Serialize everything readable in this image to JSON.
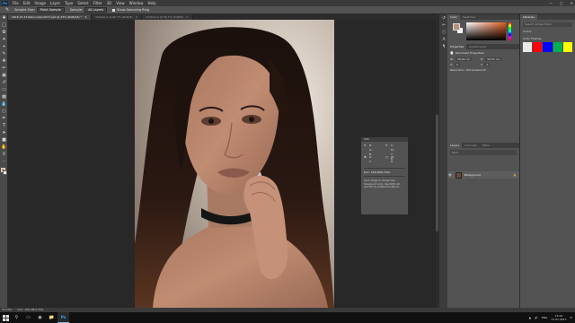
{
  "app": {
    "menu": [
      "File",
      "Edit",
      "Image",
      "Layer",
      "Type",
      "Select",
      "Filter",
      "3D",
      "View",
      "Window",
      "Help"
    ],
    "window_controls": [
      "minimize",
      "maximize",
      "close"
    ]
  },
  "options_bar": {
    "shape_label": "Sample Size:",
    "shape_value": "Point Sample",
    "sample_label": "Sample:",
    "sample_value": "All Layers",
    "show_ring_label": "Show Sampling Ring"
  },
  "tabs": [
    {
      "label": "2016-07-15 Retouched-0017.psd @ 33% (RGB/16) *",
      "active": true
    },
    {
      "label": "Untitled-1 @ 66.7% (RGB/8)",
      "active": false
    },
    {
      "label": "Untitled-2 @ 66.7% (RGB/8)",
      "active": false
    }
  ],
  "info_panel": {
    "title": "Info",
    "rows": [
      {
        "icon": "eyedropper-icon",
        "lines": [
          "R:",
          "G:",
          "B:"
        ]
      },
      {
        "icon": "eyedropper-icon",
        "lines": [
          "C:",
          "M:",
          "Y:",
          "K:"
        ]
      },
      {
        "icon": "crosshair-icon",
        "lines": [
          "X:",
          "Y:"
        ]
      },
      {
        "icon": "rect-select-icon",
        "lines": [
          "W:",
          "H:"
        ]
      }
    ],
    "doc_line": "Doc: 156.2M/1.55G",
    "hint": "Click image to choose new foreground color. Use Shift, Alt, and Ctrl for additional options."
  },
  "color_panel": {
    "tabs": [
      "Color",
      "Swatches"
    ],
    "foreground_color": "#b9907a",
    "background_color": "#ffffff"
  },
  "properties_panel": {
    "tabs": [
      "Properties",
      "Adjustments"
    ],
    "title": "Document Properties",
    "fields": [
      {
        "label": "W:",
        "value": "36,99 cm"
      },
      {
        "label": "H:",
        "value": "55,52 cm"
      },
      {
        "label": "X:",
        "value": "0"
      },
      {
        "label": "Y:",
        "value": "0"
      }
    ],
    "resolution": "Resolution: 300 pixels/inch"
  },
  "layers_panel": {
    "tabs": [
      "Layers",
      "Channels",
      "Paths"
    ],
    "filter_placeholder": "Kind",
    "layer_name": "Background"
  },
  "libraries_panel": {
    "title": "Libraries",
    "search_placeholder": "Search Adobe Stock",
    "sections": [
      "Colors",
      "Color Themes"
    ],
    "swatches": [
      "#ff0000",
      "#0000ff",
      "#00b050",
      "#ffff00"
    ]
  },
  "status_bar": {
    "zoom": "33.33%",
    "doc_info": "Doc: 156.2M/1.55G"
  },
  "taskbar": {
    "time": "13:24",
    "date": "17.07.2017",
    "lang": "ENG"
  }
}
